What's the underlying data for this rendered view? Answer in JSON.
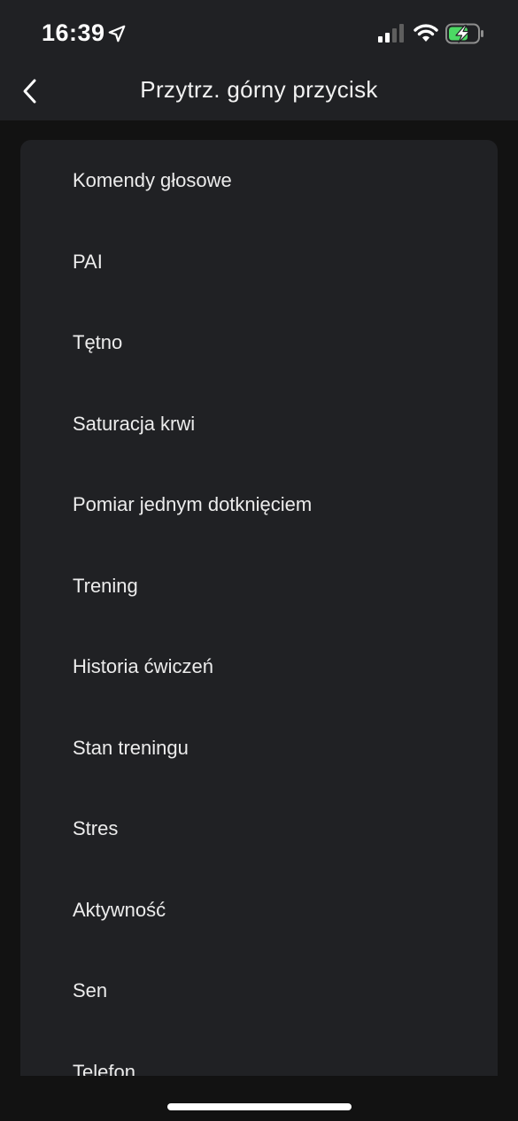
{
  "status_bar": {
    "time": "16:39",
    "icons": [
      "location-arrow-icon",
      "cellular-signal-icon",
      "wifi-icon",
      "battery-charging-icon"
    ],
    "battery_color": "#4cd964"
  },
  "header": {
    "back_icon": "chevron-left-icon",
    "title": "Przytrz. górny przycisk"
  },
  "options": {
    "items": [
      {
        "label": "Komendy głosowe"
      },
      {
        "label": "PAI"
      },
      {
        "label": "Tętno"
      },
      {
        "label": "Saturacja krwi"
      },
      {
        "label": "Pomiar jednym dotknięciem"
      },
      {
        "label": "Trening"
      },
      {
        "label": "Historia ćwiczeń"
      },
      {
        "label": "Stan treningu"
      },
      {
        "label": "Stres"
      },
      {
        "label": "Aktywność"
      },
      {
        "label": "Sen"
      },
      {
        "label": "Telefon"
      }
    ]
  },
  "colors": {
    "background": "#121212",
    "surface": "#202124",
    "text": "#ececec"
  }
}
